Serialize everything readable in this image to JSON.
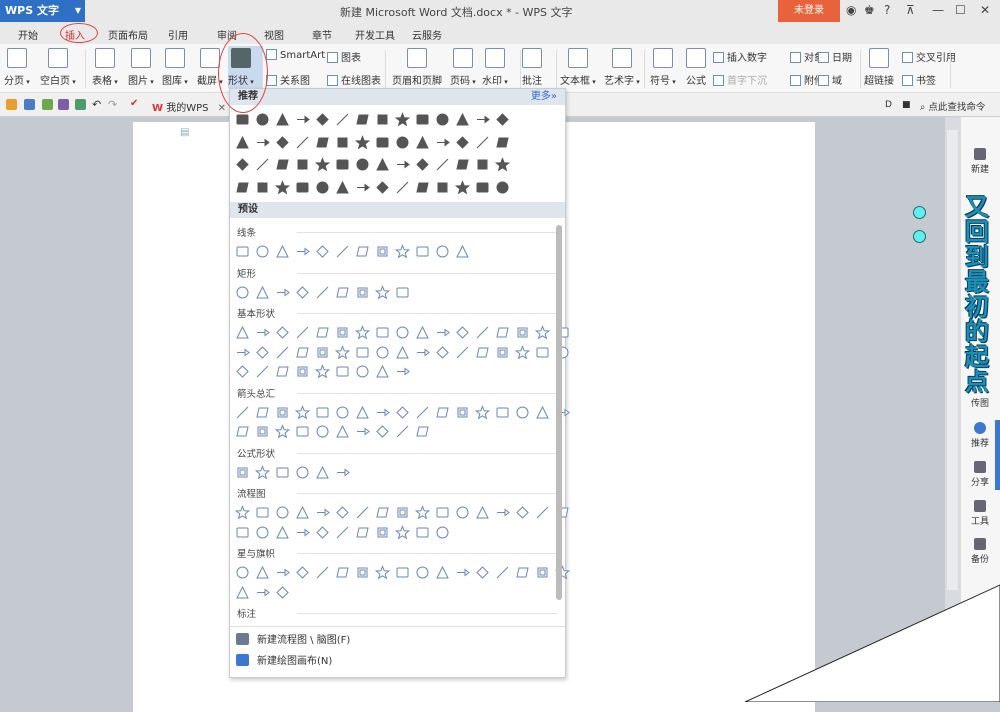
{
  "app": {
    "name": "WPS 文字",
    "title": "新建 Microsoft Word 文档.docx * - WPS 文字",
    "login": "未登录",
    "help": "?"
  },
  "tabs": [
    "开始",
    "插入",
    "页面布局",
    "引用",
    "审阅",
    "视图",
    "章节",
    "开发工具",
    "云服务"
  ],
  "active_tab": "插入",
  "ribbon": {
    "big": [
      "分页",
      "空白页",
      "表格",
      "图片",
      "图库",
      "截屏",
      "形状",
      "页眉和页脚",
      "页码",
      "水印",
      "批注",
      "文本框",
      "艺术字",
      "符号",
      "公式",
      "超链接"
    ],
    "small": [
      "SmartArt",
      "图表",
      "关系图",
      "在线图表",
      "插入数字",
      "对象",
      "日期",
      "首字下沉",
      "附件",
      "域",
      "交叉引用",
      "书签"
    ]
  },
  "quickbar": {
    "doc_tab": "我的WPS",
    "search": "点此查找命令"
  },
  "panel": {
    "recommended": "推荐",
    "more": "更多»",
    "presets": "预设",
    "recommended_rows": [
      14,
      14,
      14,
      14
    ],
    "categories": [
      {
        "name": "线条",
        "rows": [
          12
        ]
      },
      {
        "name": "矩形",
        "rows": [
          9
        ]
      },
      {
        "name": "基本形状",
        "rows": [
          17,
          17,
          9
        ]
      },
      {
        "name": "箭头总汇",
        "rows": [
          17,
          10
        ]
      },
      {
        "name": "公式形状",
        "rows": [
          6
        ]
      },
      {
        "name": "流程图",
        "rows": [
          17,
          11
        ]
      },
      {
        "name": "星与旗帜",
        "rows": [
          17,
          3
        ]
      },
      {
        "name": "标注",
        "rows": []
      }
    ],
    "actions": [
      "新建流程图 \\ 脑图(F)",
      "新建绘图画布(N)"
    ]
  },
  "sidebar": {
    "items": [
      "新建",
      "传图",
      "推荐",
      "分享",
      "工具",
      "备份"
    ],
    "overlay_text": "又回到最初的起点"
  },
  "colors": {
    "brand": "#2f6fc6",
    "login": "#e8633b",
    "highlight": "#d44444"
  }
}
